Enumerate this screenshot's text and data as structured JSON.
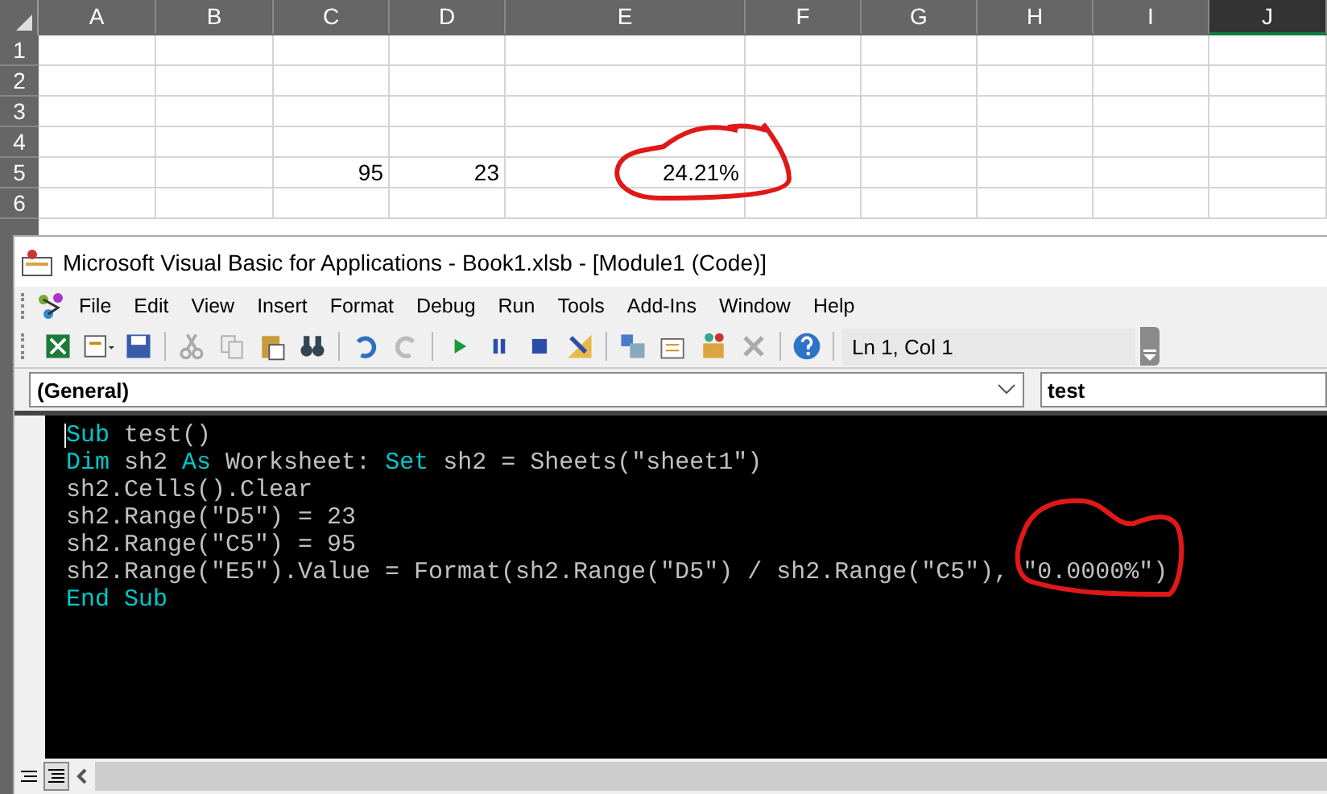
{
  "sheet": {
    "columns": [
      {
        "label": "A",
        "selected": false
      },
      {
        "label": "B",
        "selected": false
      },
      {
        "label": "C",
        "selected": false
      },
      {
        "label": "D",
        "selected": false
      },
      {
        "label": "E",
        "selected": false
      },
      {
        "label": "F",
        "selected": false
      },
      {
        "label": "G",
        "selected": false
      },
      {
        "label": "H",
        "selected": false
      },
      {
        "label": "I",
        "selected": false
      },
      {
        "label": "J",
        "selected": true
      }
    ],
    "rows": [
      {
        "label": "1",
        "cells": []
      },
      {
        "label": "2",
        "cells": []
      },
      {
        "label": "3",
        "cells": []
      },
      {
        "label": "4",
        "cells": []
      },
      {
        "label": "5",
        "cells": [
          null,
          null,
          "95",
          "23",
          "24.21%"
        ]
      },
      {
        "label": "6",
        "cells": []
      }
    ]
  },
  "window": {
    "title": "Microsoft Visual Basic for Applications - Book1.xlsb - [Module1 (Code)]"
  },
  "menu": [
    {
      "label": "File"
    },
    {
      "label": "Edit"
    },
    {
      "label": "View"
    },
    {
      "label": "Insert"
    },
    {
      "label": "Format"
    },
    {
      "label": "Debug"
    },
    {
      "label": "Run"
    },
    {
      "label": "Tools"
    },
    {
      "label": "Add-Ins"
    },
    {
      "label": "Window"
    },
    {
      "label": "Help"
    }
  ],
  "toolbar": {
    "position": "Ln 1, Col 1"
  },
  "object_box": {
    "value": "(General)"
  },
  "procedure_box": {
    "value": "test"
  },
  "code": [
    [
      {
        "kind": "keyword",
        "text": "Sub"
      },
      {
        "kind": "text",
        "text": " test()"
      }
    ],
    [
      {
        "kind": "keyword",
        "text": "Dim"
      },
      {
        "kind": "text",
        "text": " sh2 "
      },
      {
        "kind": "keyword",
        "text": "As"
      },
      {
        "kind": "text",
        "text": " Worksheet: "
      },
      {
        "kind": "keyword",
        "text": "Set"
      },
      {
        "kind": "text",
        "text": " sh2 = Sheets(\"sheet1\")"
      }
    ],
    [
      {
        "kind": "text",
        "text": "sh2.Cells().Clear"
      }
    ],
    [
      {
        "kind": "text",
        "text": "sh2.Range(\"D5\") = 23"
      }
    ],
    [
      {
        "kind": "text",
        "text": "sh2.Range(\"C5\") = 95"
      }
    ],
    [
      {
        "kind": "text",
        "text": "sh2.Range(\"E5\").Value = Format(sh2.Range(\"D5\") / sh2.Range(\"C5\"), \"0.0000%\")"
      }
    ],
    [
      {
        "kind": "keyword",
        "text": "End Sub"
      }
    ]
  ],
  "view_buttons": [
    {
      "selected": false
    },
    {
      "selected": true
    }
  ]
}
